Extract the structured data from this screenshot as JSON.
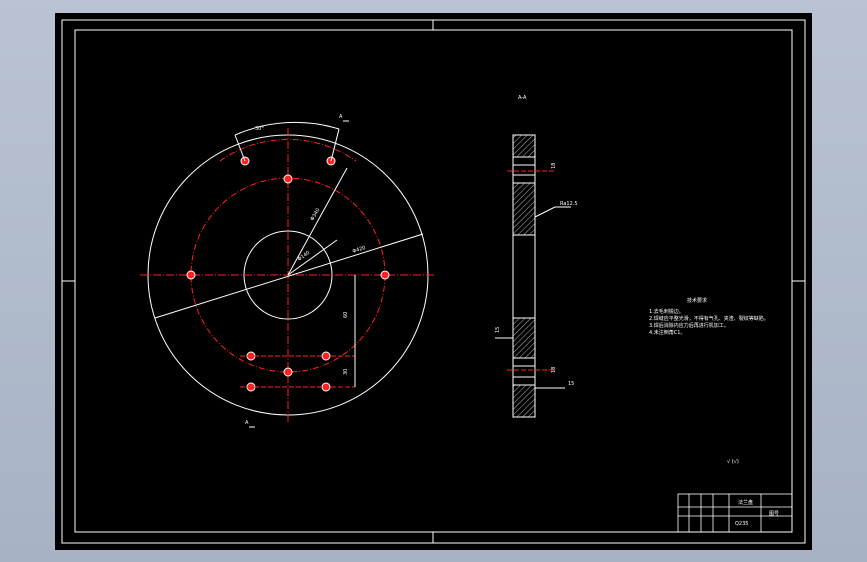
{
  "colors": {
    "background_outer": "#b3bdcd",
    "sheet": "#000000",
    "line": "#ffffff",
    "centerline": "#ff2020",
    "hatch": "#ffffff"
  },
  "section_marks": {
    "top_label": "A",
    "bottom_label": "A",
    "section_view_label": "A-A"
  },
  "dimensions": {
    "angle_top": "30°",
    "d_hole_circle": "Φ340",
    "d_outer": "Φ420",
    "d_inner": "Φ140",
    "spacing_1": "60",
    "spacing_2": "30",
    "thickness_top": "18",
    "thickness_bottom": "18",
    "weld_1": "15",
    "weld_2": "15",
    "roughness": "Ra12.5"
  },
  "notes": {
    "title": "技术要求",
    "lines": [
      "1.去毛刺锐边。",
      "2.焊缝应平整光滑，不得有气孔、夹渣、裂纹等缺陷。",
      "3.焊后消除内应力后再进行机加工。",
      "4.未注倒角C1。"
    ]
  },
  "surface_finish": "√ (√)",
  "title_block": {
    "part_name": "法兰盘",
    "drawing_no": "图号",
    "material": "Q235"
  }
}
